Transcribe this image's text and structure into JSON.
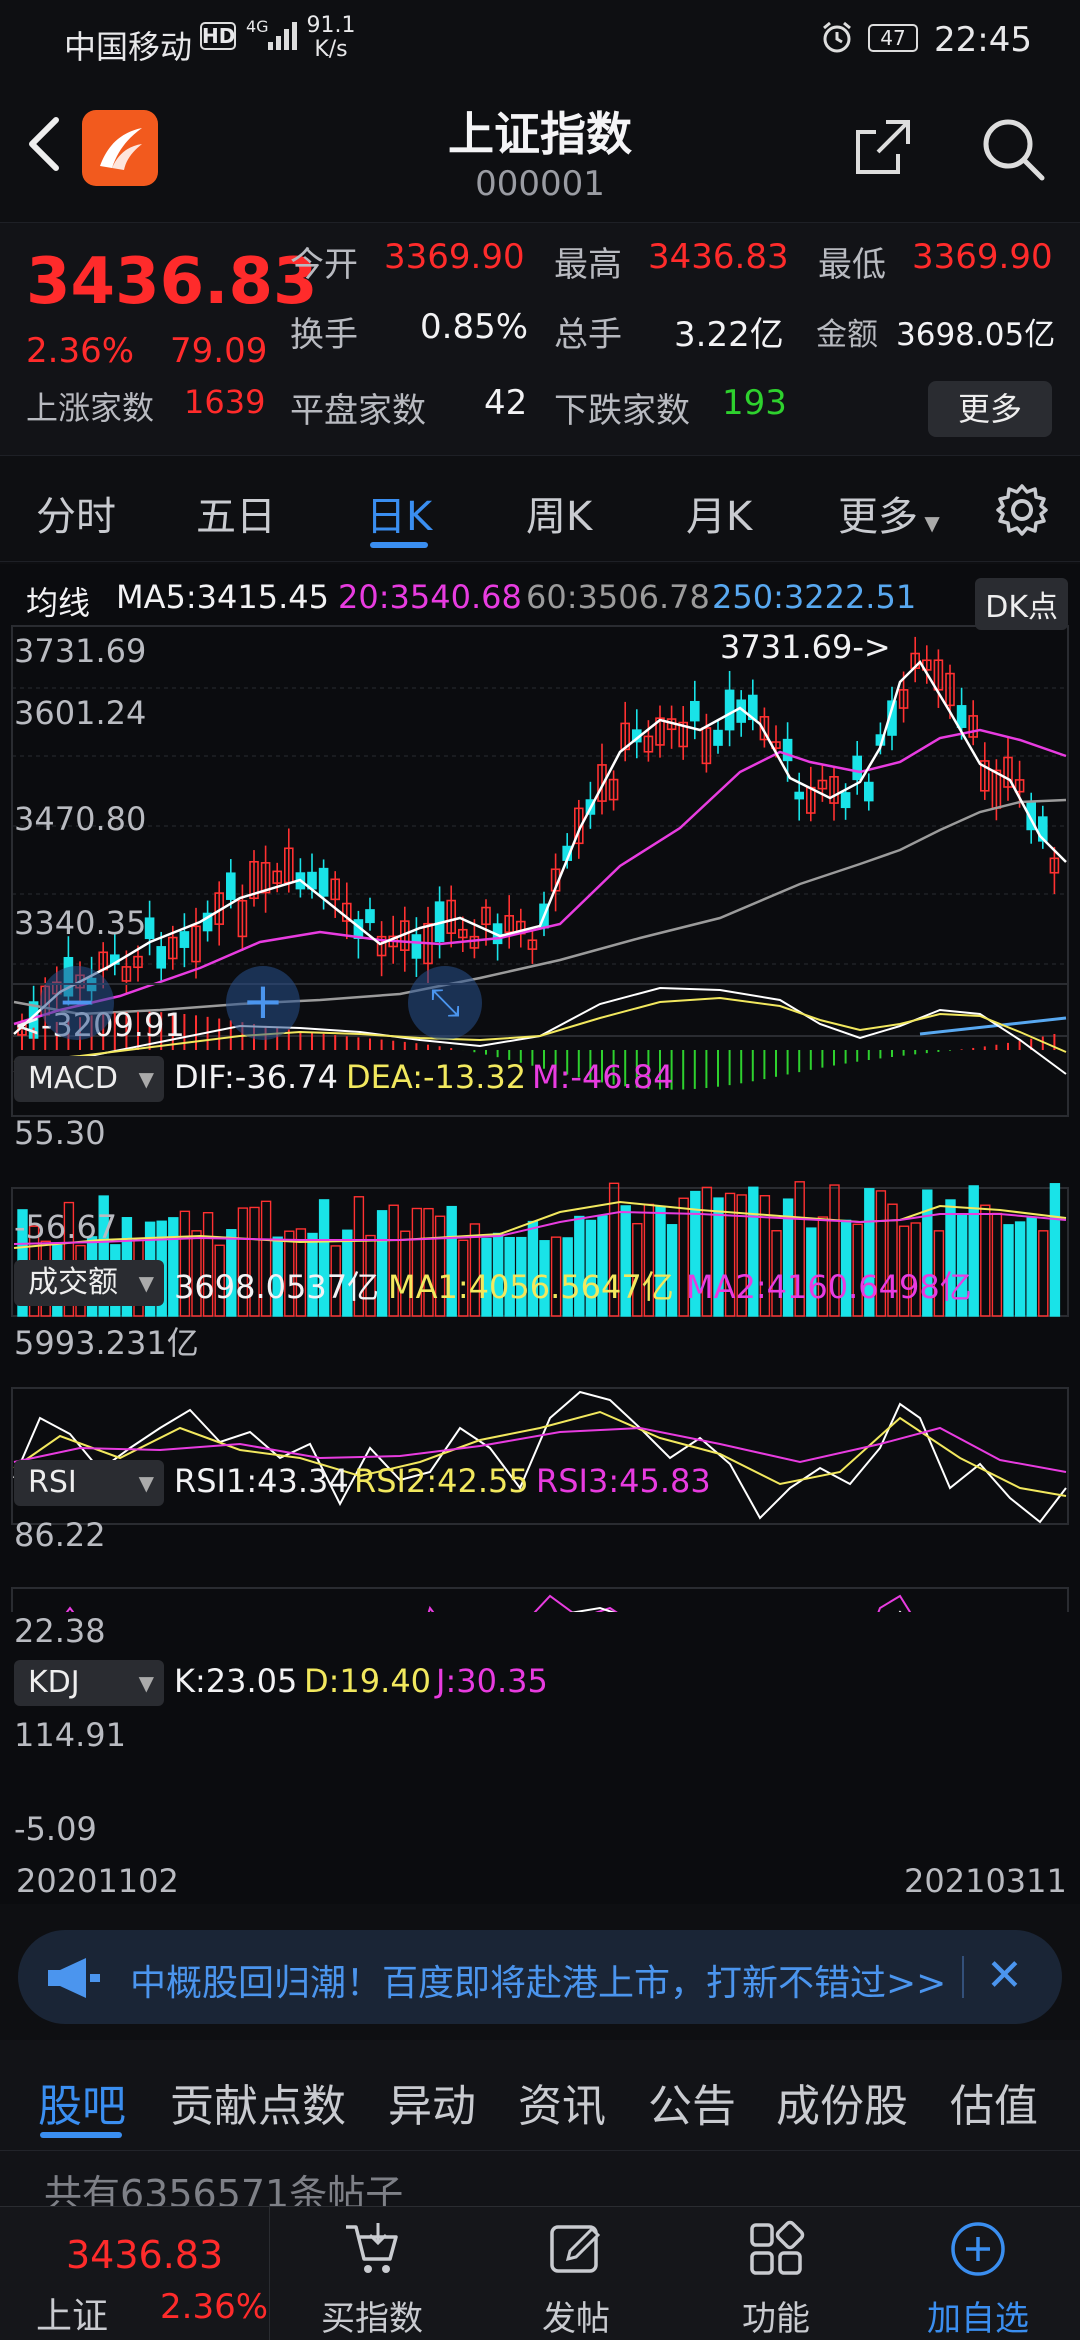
{
  "status_bar": {
    "carrier": "中国移动",
    "hd": "HD",
    "network": "4G",
    "speed_value": "91.1",
    "speed_unit": "K/s",
    "battery": "47",
    "time": "22:45"
  },
  "header": {
    "title": "上证指数",
    "code": "000001"
  },
  "quote": {
    "price": "3436.83",
    "change_pct": "2.36%",
    "change": "79.09",
    "stats": [
      {
        "label": "今开",
        "value": "3369.90",
        "color": "#ff2b2b"
      },
      {
        "label": "最高",
        "value": "3436.83",
        "color": "#ff2b2b"
      },
      {
        "label": "最低",
        "value": "3369.90",
        "color": "#ff2b2b"
      },
      {
        "label": "换手",
        "value": "0.85%",
        "color": "#f2f2f4"
      },
      {
        "label": "总手",
        "value": "3.22亿",
        "color": "#f2f2f4"
      },
      {
        "label": "金额",
        "value": "3698.05亿",
        "color": "#f2f2f4"
      }
    ],
    "rise_label": "上涨家数",
    "rise_value": "1639",
    "flat_label": "平盘家数",
    "flat_value": "42",
    "fall_label": "下跌家数",
    "fall_value": "193",
    "more_label": "更多"
  },
  "period_tabs": {
    "items": [
      "分时",
      "五日",
      "日K",
      "周K",
      "月K",
      "更多"
    ],
    "active": "日K"
  },
  "ma_legend": {
    "label": "均线",
    "ma5": "MA5:3415.45",
    "ma20": "20:3540.68",
    "ma60": "60:3506.78",
    "ma250": "250:3222.51",
    "dk_label": "DK点",
    "colors": {
      "ma5": "#ffffff",
      "ma20": "#e83ce0",
      "ma60": "#9b9b9b",
      "ma250": "#58a8f0"
    }
  },
  "kline": {
    "y_labels": [
      "3731.69",
      "3601.24",
      "3470.80",
      "3340.35"
    ],
    "max_marker": "3731.69->",
    "min_marker": "<-3209.91",
    "zoom_out": "−",
    "zoom_in": "+",
    "fullscreen": "⤡"
  },
  "macd": {
    "label": "MACD",
    "dif": "DIF:-36.74",
    "dea": "DEA:-13.32",
    "m": "M:-46.84",
    "y_top": "55.30",
    "y_bottom": "-56.67"
  },
  "volume": {
    "label": "成交额",
    "value": "3698.0537亿",
    "ma1": "MA1:4056.5647亿",
    "ma2": "MA2:4160.6498亿",
    "y_top": "5993.231亿"
  },
  "rsi": {
    "label": "RSI",
    "rsi1": "RSI1:43.34",
    "rsi2": "RSI2:42.55",
    "rsi3": "RSI3:45.83",
    "y_top": "86.22",
    "y_bottom": "22.38"
  },
  "kdj": {
    "label": "KDJ",
    "k": "K:23.05",
    "d": "D:19.40",
    "j": "J:30.35",
    "y_top": "114.91",
    "y_bottom": "-5.09"
  },
  "dates": {
    "start": "20201102",
    "end": "20210311"
  },
  "banner": {
    "text": "中概股回归潮！百度即将赴港上市，打新不错过>>"
  },
  "section_tabs": {
    "items": [
      "股吧",
      "贡献点数",
      "异动",
      "资讯",
      "公告",
      "成份股",
      "估值"
    ],
    "active": "股吧"
  },
  "posts": {
    "text": "共有6356571条帖子"
  },
  "bottom_bar": {
    "index_value": "3436.83",
    "index_name": "上证",
    "index_pct": "2.36%",
    "items": [
      {
        "label": "买指数",
        "icon": "cart-icon"
      },
      {
        "label": "发帖",
        "icon": "edit-icon"
      },
      {
        "label": "功能",
        "icon": "grid-icon"
      },
      {
        "label": "加自选",
        "icon": "plus-circle-icon"
      }
    ]
  }
}
